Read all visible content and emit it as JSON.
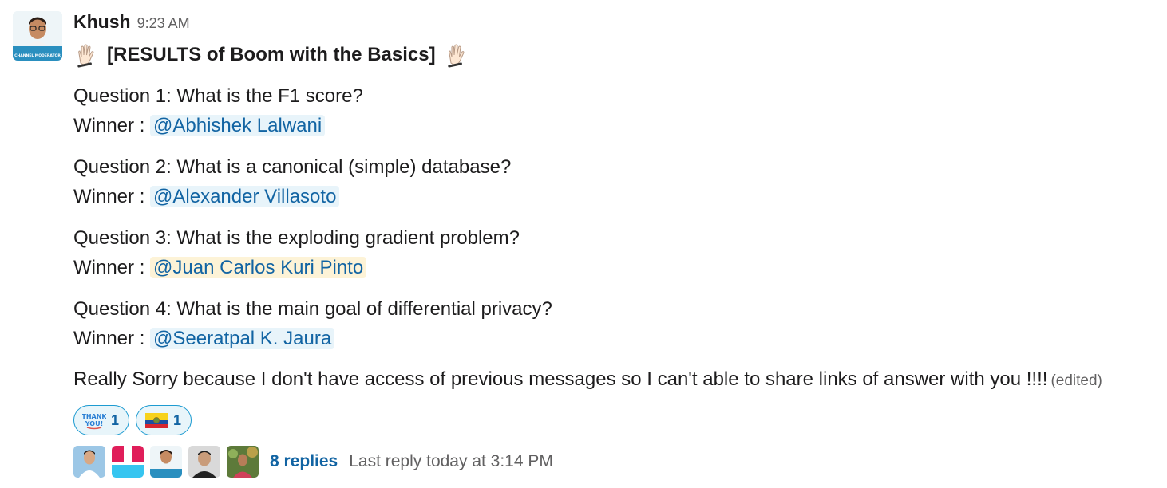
{
  "message": {
    "sender": "Khush",
    "time": "9:23 AM",
    "title": "[RESULTS of Boom with the Basics]",
    "questions": [
      {
        "question": "Question 1: What is the F1 score?",
        "winner_label": "Winner : ",
        "winner": "@Abhishek Lalwani"
      },
      {
        "question": "Question 2: What is a canonical (simple) database?",
        "winner_label": "Winner : ",
        "winner": "@Alexander Villasoto"
      },
      {
        "question": "Question 3: What is the exploding gradient problem?",
        "winner_label": "Winner : ",
        "winner": "@Juan Carlos Kuri Pinto"
      },
      {
        "question": "Question 4: What is the main goal of differential privacy?",
        "winner_label": "Winner : ",
        "winner": "@Seeratpal K. Jaura"
      }
    ],
    "footer_text": "Really Sorry because I don't have access of previous messages so I can't able to share links of answer with you !!!!",
    "edited": "(edited)",
    "avatar_badge": "CHANNEL MODERATOR"
  },
  "reactions": [
    {
      "emoji": "thank-you-emoji",
      "text": "THANK YOU!",
      "count": "1"
    },
    {
      "emoji": "ecuador-flag-emoji",
      "count": "1"
    }
  ],
  "thread": {
    "replies": "8 replies",
    "last_reply": "Last reply today at 3:14 PM"
  },
  "colors": {
    "link": "#1264a3",
    "mention_bg": "#e8f4fa",
    "self_mention_bg": "#fdf3d7",
    "reaction_border": "#1d9bd1"
  }
}
